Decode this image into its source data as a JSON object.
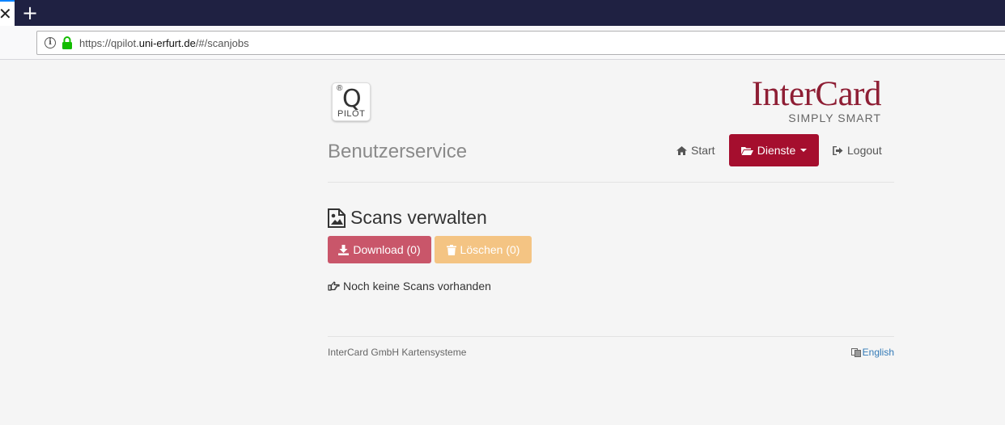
{
  "browser": {
    "tab_close": "✕",
    "new_tab": "+",
    "url_prefix": "https://qpilot.",
    "url_domain": "uni-erfurt.de",
    "url_path": "/#/scanjobs"
  },
  "header": {
    "qpilot_reg": "®",
    "qpilot_q": "Q",
    "qpilot_pilot": "PILOT",
    "brand_name": "InterCard",
    "brand_slogan": "SIMPLY SMART",
    "brand_color": "#8e1e34",
    "page_title": "Benutzerservice"
  },
  "nav": {
    "start_label": "Start",
    "dienste_label": "Dienste",
    "logout_label": "Logout",
    "active_color": "#a50e2e"
  },
  "main": {
    "section_title": "Scans verwalten",
    "download_label": "Download (0)",
    "delete_label": "Löschen (0)",
    "empty_message": "Noch keine Scans vorhanden"
  },
  "footer": {
    "company": "InterCard GmbH Kartensysteme",
    "language_label": "English"
  }
}
